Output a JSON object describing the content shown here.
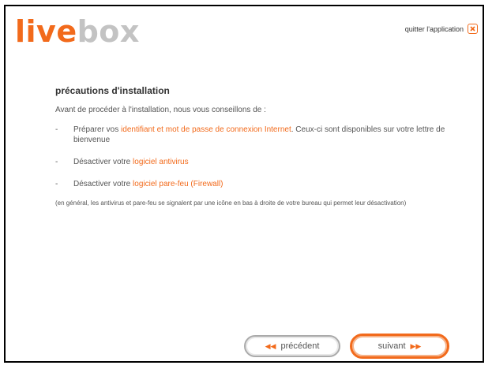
{
  "header": {
    "logo_part1": "live",
    "logo_part2": "box",
    "quit_label": "quitter l'application"
  },
  "main": {
    "title": "précautions d'installation",
    "intro": "Avant de procéder à l'installation, nous vous conseillons de :",
    "bullet": "-",
    "items": [
      {
        "prefix": "Préparer vos ",
        "highlight": "identifiant et mot de passe de connexion Internet",
        "suffix": ". Ceux-ci sont disponibles sur votre lettre de bienvenue"
      },
      {
        "prefix": "Désactiver votre ",
        "highlight": "logiciel antivirus",
        "suffix": ""
      },
      {
        "prefix": "Désactiver votre ",
        "highlight": "logiciel pare-feu (Firewall)",
        "suffix": ""
      }
    ],
    "note": "(en général, les antivirus et pare-feu se signalent par une icône en bas à droite de votre bureau qui permet leur désactivation)"
  },
  "nav": {
    "prev_label": "précédent",
    "prev_arrow": "◀◀",
    "next_label": "suivant",
    "next_arrow": "▶▶"
  },
  "colors": {
    "accent": "#f26a1b",
    "logo_grey": "#c3c3c3",
    "text": "#555555"
  },
  "icons": {
    "quit": "close-icon",
    "prev": "double-chevron-left-icon",
    "next": "double-chevron-right-icon"
  }
}
